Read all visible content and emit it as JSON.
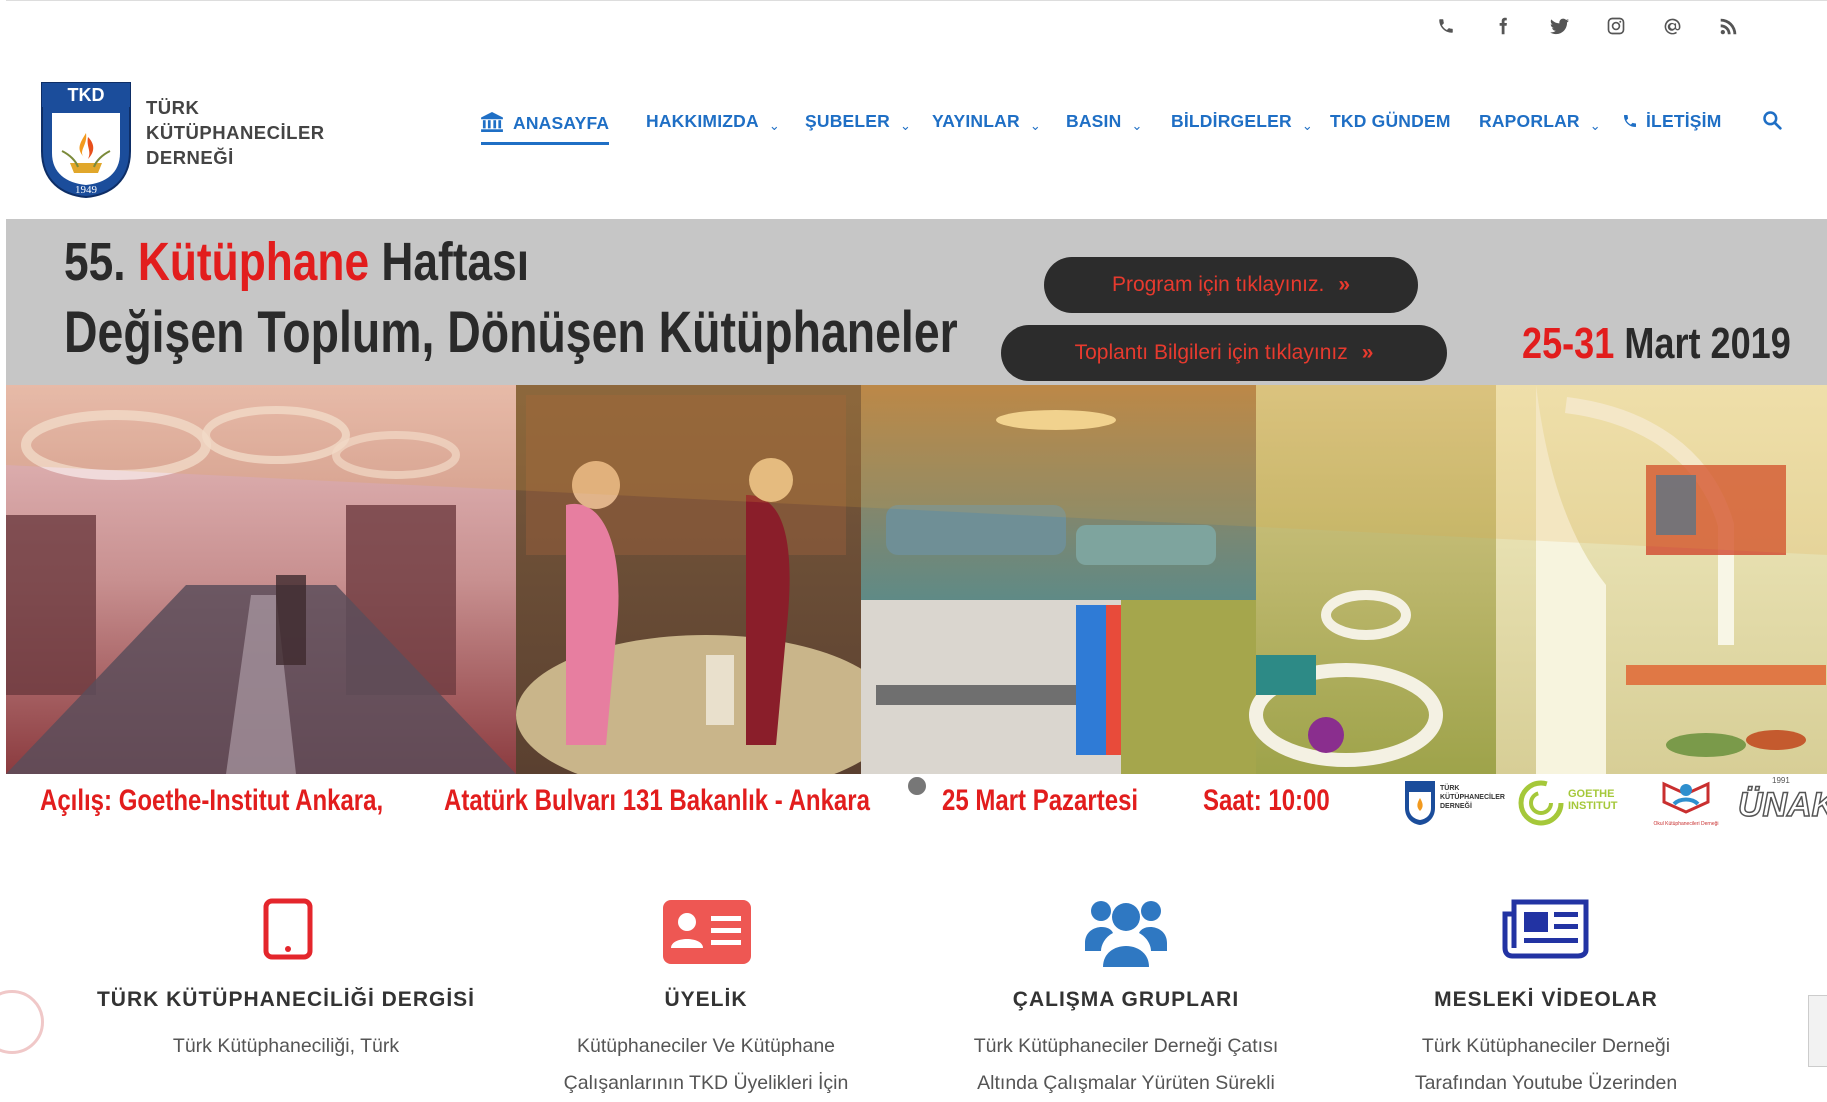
{
  "topbar": {
    "icons": [
      "phone-icon",
      "facebook-icon",
      "twitter-icon",
      "instagram-icon",
      "at-icon",
      "rss-icon"
    ]
  },
  "logo": {
    "abbr": "TKD",
    "year": "1949",
    "line1": "TÜRK",
    "line2": "KÜTÜPHANECİLER",
    "line3": "DERNEĞİ"
  },
  "nav": {
    "items": [
      {
        "label": "ANASAYFA",
        "active": true
      },
      {
        "label": "HAKKIMIZDA",
        "dropdown": true
      },
      {
        "label": "ŞUBELER",
        "dropdown": true
      },
      {
        "label": "YAYINLAR",
        "dropdown": true
      },
      {
        "label": "BASIN",
        "dropdown": true
      },
      {
        "label": "BİLDİRGELER",
        "dropdown": true
      },
      {
        "label": "TKD GÜNDEM"
      },
      {
        "label": "RAPORLAR",
        "dropdown": true
      },
      {
        "label": "İLETİŞİM"
      }
    ]
  },
  "banner": {
    "title_prefix": "55.",
    "title_highlight": "Kütüphane",
    "title_suffix": "Haftası",
    "subtitle": "Değişen Toplum, Dönüşen Kütüphaneler",
    "button_program": "Program için tıklayınız.",
    "button_meeting": "Toplantı Bilgileri için tıklayınız",
    "date_red": "25-31",
    "date_rest": "Mart 2019",
    "bottom_opening": "Açılış: Goethe-Institut Ankara,",
    "bottom_address": "Atatürk Bulvarı 131 Bakanlık - Ankara",
    "bottom_day": "25 Mart Pazartesi",
    "bottom_time": "Saat: 10:00",
    "partner_tkd": "TÜRK KÜTÜPHANECİLER DERNEĞİ",
    "partner_goethe_1": "GOETHE",
    "partner_goethe_2": "INSTITUT",
    "partner_okul": "Okul Kütüphanecileri Derneği",
    "partner_unak": "ÜNAK",
    "partner_unak_year": "1991"
  },
  "features": [
    {
      "title": "TÜRK KÜTÜPHANECİLİĞİ DERGİSİ",
      "desc": "Türk Kütüphaneciliği, Türk",
      "icon": "tablet-icon",
      "color": "#e4262c"
    },
    {
      "title": "ÜYELİK",
      "desc": "Kütüphaneciler Ve Kütüphane Çalışanlarının TKD Üyelikleri İçin",
      "icon": "id-card-icon",
      "color": "#ee5753"
    },
    {
      "title": "ÇALIŞMA GRUPLARI",
      "desc": "Türk Kütüphaneciler Derneği Çatısı Altında Çalışmalar Yürüten Sürekli",
      "icon": "users-icon",
      "color": "#2f78c2"
    },
    {
      "title": "MESLEKİ VİDEOLAR",
      "desc": "Türk Kütüphaneciler Derneği Tarafından Youtube Üzerinden",
      "icon": "newspaper-icon",
      "color": "#2233a3"
    }
  ]
}
